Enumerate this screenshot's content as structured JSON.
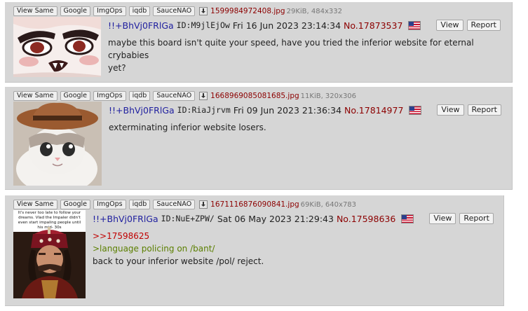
{
  "search_buttons": [
    "View Same",
    "Google",
    "ImgOps",
    "iqdb",
    "SauceNAO"
  ],
  "colors": {
    "post_bg": "#d6d6d6",
    "trip": "#1f1f9f",
    "postno": "#8c0000",
    "greentext": "#5b7f00",
    "quotelink": "#c00000"
  },
  "icons": {
    "download": "download-icon",
    "flag": "us-flag-icon"
  },
  "posts": [
    {
      "file": {
        "name": "1599984972408.jpg",
        "meta": "29KiB, 484x332"
      },
      "tripcode": "!!+BhVj0FRlGa",
      "id": "ID:M9jlEjOw",
      "date": "Fri 16 Jun 2023 23:14:34",
      "number": "No.17873537",
      "view": "View",
      "report": "Report",
      "lines": [
        "maybe this board isn't quite your speed, have you tried the inferior website for eternal crybabies",
        "yet?"
      ]
    },
    {
      "file": {
        "name": "1668969085081685.jpg",
        "meta": "11KiB, 320x306"
      },
      "tripcode": "!!+BhVj0FRlGa",
      "id": "ID:RiaJjrvm",
      "date": "Fri 09 Jun 2023 21:36:34",
      "number": "No.17814977",
      "view": "View",
      "report": "Report",
      "lines": [
        "exterminating inferior website losers."
      ]
    },
    {
      "file": {
        "name": "1671116876090841.jpg",
        "meta": "69KiB, 640x783"
      },
      "tripcode": "!!+BhVj0FRlGa",
      "id": "ID:NuE+ZPW/",
      "date": "Sat 06 May 2023 21:29:43",
      "number": "No.17598636",
      "view": "View",
      "report": "Report",
      "quote": ">>17598625",
      "greentext": ">language policing on /bant/",
      "lines": [
        "back to your inferior website /pol/ reject."
      ],
      "thumb_caption": "It's never too late to follow your dreams. Vlad the Impaler didn't even start impaling people until his mid- 30s"
    }
  ]
}
